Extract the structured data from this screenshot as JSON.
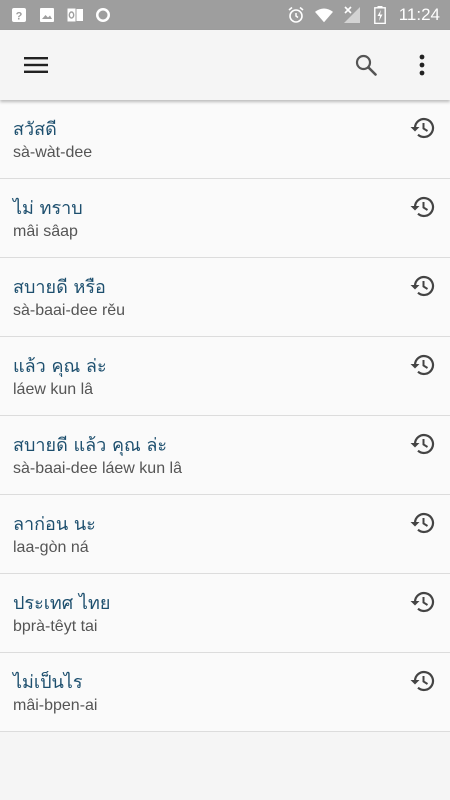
{
  "status_bar": {
    "time": "11:24",
    "left_icons": [
      "help-box-icon",
      "image-icon",
      "outlook-icon",
      "record-icon"
    ],
    "right_icons": [
      "alarm-icon",
      "wifi-icon",
      "signal-icon",
      "battery-charging-icon"
    ]
  },
  "app_bar": {
    "menu_icon": "hamburger-menu-icon",
    "search_icon": "search-icon",
    "more_icon": "more-vert-icon"
  },
  "phrases": [
    {
      "thai": "สวัสดี",
      "roman": "sà-wàt-dee"
    },
    {
      "thai": "ไม่ ทราบ",
      "roman": "mâi sâap"
    },
    {
      "thai": "สบายดี หรือ",
      "roman": "sà-baai-dee rěu"
    },
    {
      "thai": "แล้ว คุณ ล่ะ",
      "roman": "láew kun lâ"
    },
    {
      "thai": "สบายดี แล้ว คุณ ล่ะ",
      "roman": "sà-baai-dee láew kun lâ"
    },
    {
      "thai": "ลาก่อน นะ",
      "roman": "laa-gòn ná"
    },
    {
      "thai": "ประเทศ ไทย",
      "roman": "bprà-têyt tai"
    },
    {
      "thai": "ไม่เป็นไร",
      "roman": "mâi-bpen-ai"
    }
  ],
  "colors": {
    "status_bar": "#9e9e9e",
    "thai_text": "#1d4f6e",
    "roman_text": "#555555",
    "icon": "#444444"
  }
}
